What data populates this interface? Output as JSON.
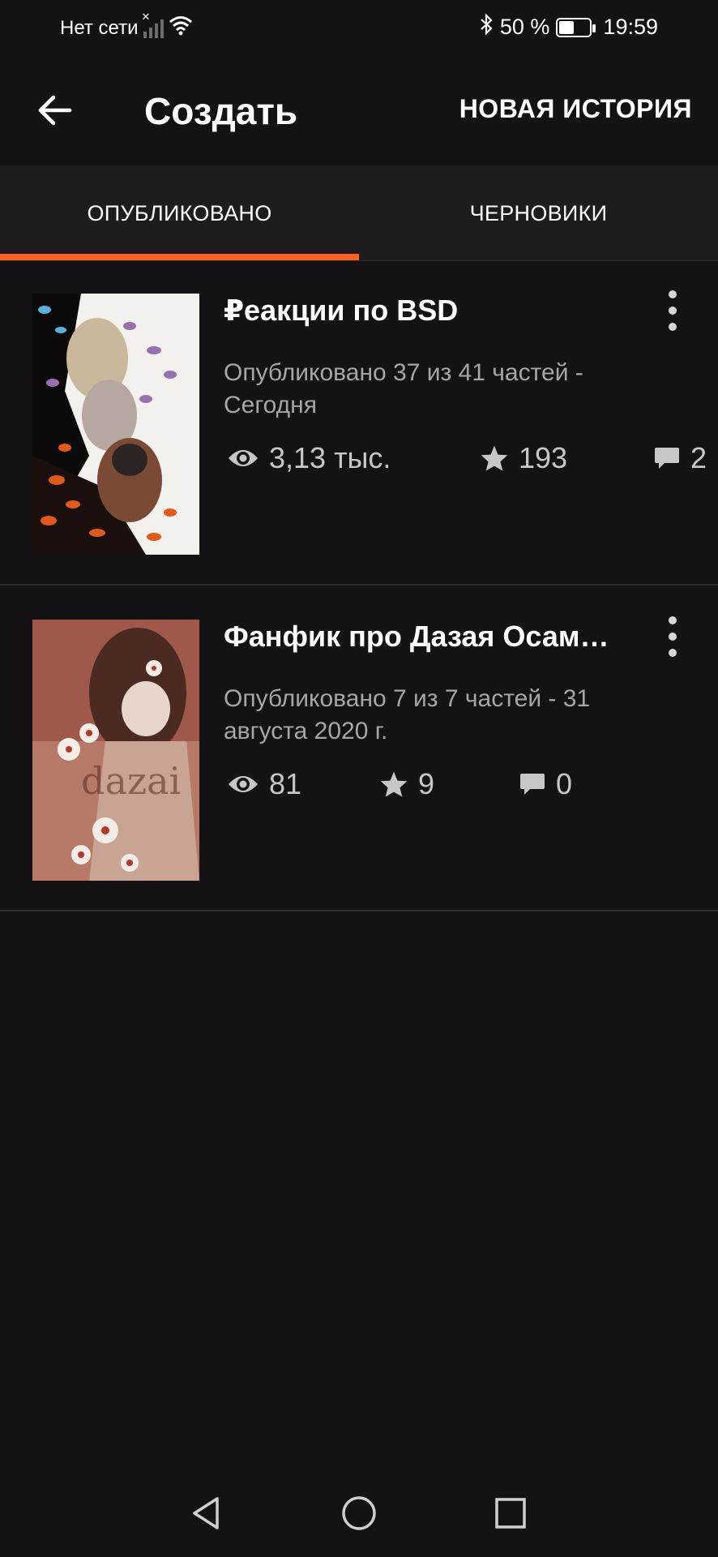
{
  "status_bar": {
    "carrier": "Нет сети",
    "battery": "50 %",
    "battery_level": 0.5,
    "time": "19:59"
  },
  "appbar": {
    "title": "Создать",
    "new_story_label": "НОВАЯ ИСТОРИЯ"
  },
  "tabs": [
    {
      "label": "ОПУБЛИКОВАНО",
      "active": true
    },
    {
      "label": "ЧЕРНОВИКИ",
      "active": false
    }
  ],
  "colors": {
    "accent": "#ff6122",
    "background": "#141215",
    "secondary_text": "#a8a5aa"
  },
  "stories": [
    {
      "title": "₽еакции по BSD",
      "meta": "Опубликовано 37 из 41 частей - Сегодня",
      "views": "3,13 тыс.",
      "votes": "193",
      "comments": "2"
    },
    {
      "title": "Фанфик про Дазая Осам…",
      "meta": "Опубликовано 7 из 7 частей - 31 августа 2020 г.",
      "views": "81",
      "votes": "9",
      "comments": "0"
    }
  ]
}
